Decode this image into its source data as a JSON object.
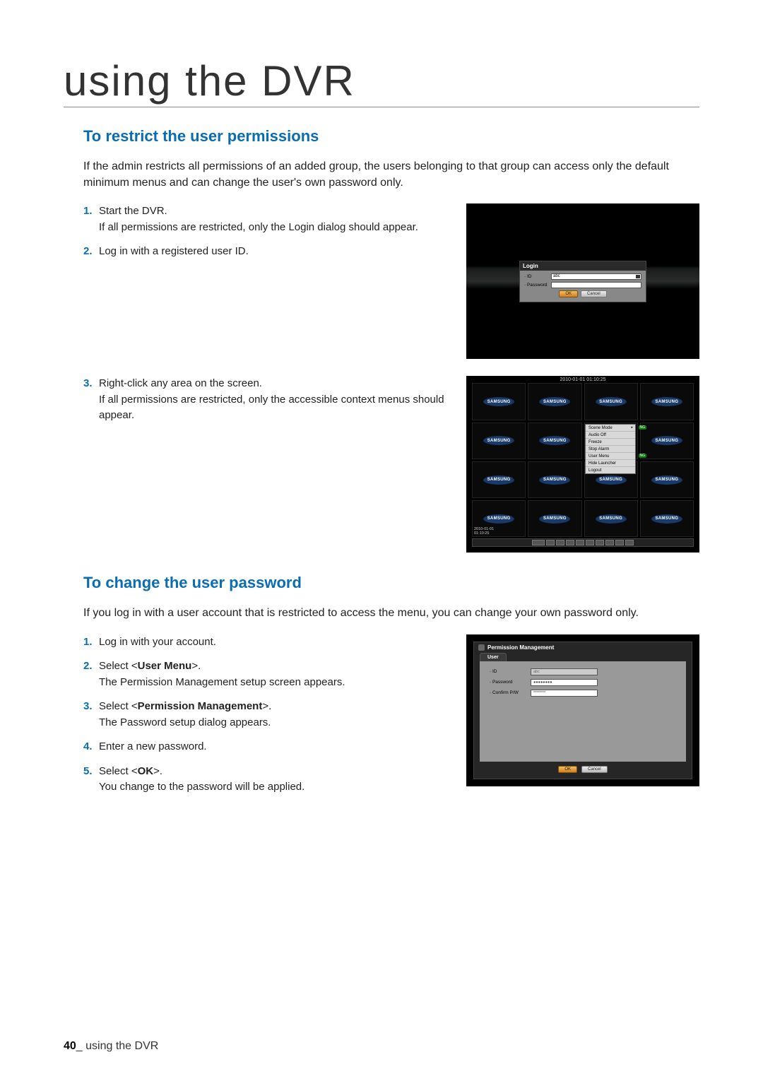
{
  "main_title": "using the DVR",
  "section1": {
    "title": "To restrict the user permissions",
    "intro": "If the admin restricts all permissions of an added group, the users belonging to that group can access only the default minimum menus and can change the user's own password only.",
    "steps": [
      {
        "num": "1.",
        "text_before": "Start the DVR.",
        "text_after": "If all permissions are restricted, only the Login dialog should appear."
      },
      {
        "num": "2.",
        "text_before": "Log in with a registered user ID.",
        "text_after": ""
      },
      {
        "num": "3.",
        "text_before": "Right-click any area on the screen.",
        "text_after": "If all permissions are restricted, only the accessible context menus should appear."
      }
    ]
  },
  "section2": {
    "title": "To change the user password",
    "intro": "If you log in with a user account that is restricted to access the menu, you can change your own password only.",
    "steps": [
      {
        "num": "1.",
        "text": "Log in with your account."
      },
      {
        "num": "2.",
        "pre": "Select <",
        "bold": "User Menu",
        "post": ">.",
        "after": "The Permission Management setup screen appears."
      },
      {
        "num": "3.",
        "pre": "Select <",
        "bold": "Permission Management",
        "post": ">.",
        "after": "The Password setup dialog appears."
      },
      {
        "num": "4.",
        "text": "Enter a new password."
      },
      {
        "num": "5.",
        "pre": "Select <",
        "bold": "OK",
        "post": ">.",
        "after": "You change to the password will be applied."
      }
    ]
  },
  "login_shot": {
    "title": "Login",
    "id_label": "· ID",
    "id_value": "abc",
    "pw_label": "· Password",
    "ok": "OK",
    "cancel": "Cancel"
  },
  "context_shot": {
    "logo": "SAMSUNG",
    "timestamp_top": "2010-01-01 01:10:25",
    "timestamp_bottom_date": "2010-01-01",
    "timestamp_bottom_time": "01:10:25",
    "menu": [
      "Scene Mode",
      "Audio Off",
      "Freeze",
      "Stop Alarm",
      "User Menu",
      "Hide Launcher",
      "Logout"
    ],
    "ng": "NG"
  },
  "perm_shot": {
    "title": "Permission Management",
    "tab": "User",
    "id_label": "· ID",
    "id_value": "abc",
    "pw_label": "· Password",
    "pw_value": "●●●●●●●●",
    "confirm_label": "· Confirm P/W",
    "confirm_value": "********",
    "ok": "OK",
    "cancel": "Cancel"
  },
  "footer": {
    "page": "40",
    "sep": "_ ",
    "label": "using the DVR"
  }
}
